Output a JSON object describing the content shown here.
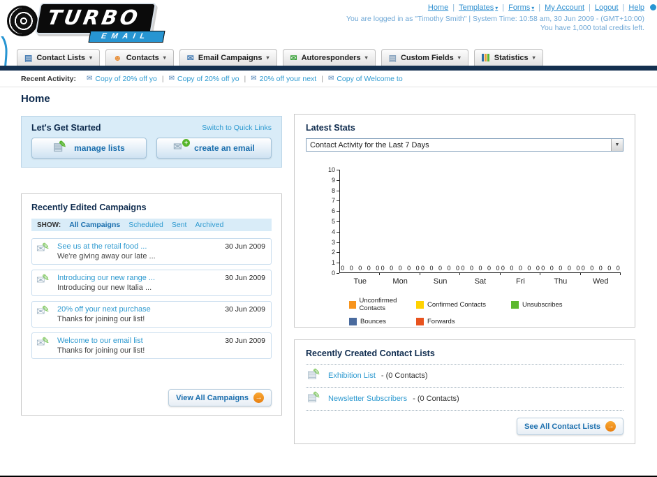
{
  "icons": {
    "chevron_down": "▾",
    "separator": "|",
    "arrow_right": "→",
    "envelope": "✉",
    "pencil": "✎",
    "card": "▤",
    "person": "☻",
    "select_arrow": "▼",
    "plus": "+"
  },
  "header": {
    "logo_primary": "TURBO",
    "logo_secondary": "EMAIL",
    "links": [
      {
        "label": "Home"
      },
      {
        "label": "Templates"
      },
      {
        "label": "Forms"
      },
      {
        "label": "My Account"
      },
      {
        "label": "Logout"
      },
      {
        "label": "Help"
      }
    ],
    "status_line1": "You are logged in as \"Timothy Smith\" | System Time: 10:58 am, 30 Jun 2009 - (GMT+10:00)",
    "status_line2": "You have 1,000 total credits left."
  },
  "nav_tabs": [
    {
      "label": "Contact Lists"
    },
    {
      "label": "Contacts"
    },
    {
      "label": "Email Campaigns"
    },
    {
      "label": "Autoresponders"
    },
    {
      "label": "Custom Fields"
    },
    {
      "label": "Statistics"
    }
  ],
  "recent_activity": {
    "label": "Recent Activity:",
    "items": [
      "Copy of 20% off yo",
      "Copy of 20% off yo",
      "20% off your next",
      "Copy of Welcome to"
    ]
  },
  "page": {
    "title": "Home"
  },
  "get_started": {
    "title": "Let's Get Started",
    "switch_link": "Switch to Quick Links",
    "manage_lists": "manage lists",
    "create_email": "create an email"
  },
  "campaigns": {
    "title": "Recently Edited Campaigns",
    "show_label": "SHOW:",
    "tabs": [
      "All Campaigns",
      "Scheduled",
      "Sent",
      "Archived"
    ],
    "items": [
      {
        "title": "See us at the retail food ...",
        "subtitle": "We're giving away our late ...",
        "date": "30 Jun 2009"
      },
      {
        "title": "Introducing our new range ...",
        "subtitle": "Introducing our new Italia ...",
        "date": "30 Jun 2009"
      },
      {
        "title": "20% off your next purchase",
        "subtitle": "Thanks for joining our list!",
        "date": "30 Jun 2009"
      },
      {
        "title": "Welcome to our email list",
        "subtitle": "Thanks for joining our list!",
        "date": "30 Jun 2009"
      }
    ],
    "view_all": "View All Campaigns"
  },
  "stats": {
    "title": "Latest Stats",
    "dropdown_value": "Contact Activity for the Last 7 Days",
    "chart_data": {
      "type": "bar",
      "title": "Contact Activity for the Last 7 Days",
      "categories": [
        "Tue",
        "Mon",
        "Sun",
        "Sat",
        "Fri",
        "Thu",
        "Wed"
      ],
      "series": [
        {
          "name": "Unconfirmed Contacts",
          "color": "#f7941d",
          "values": [
            0,
            0,
            0,
            0,
            0,
            0,
            0
          ]
        },
        {
          "name": "Confirmed Contacts",
          "color": "#ffd200",
          "values": [
            0,
            0,
            0,
            0,
            0,
            0,
            0
          ]
        },
        {
          "name": "Unsubscribes",
          "color": "#5cb82e",
          "values": [
            0,
            0,
            0,
            0,
            0,
            0,
            0
          ]
        },
        {
          "name": "Bounces",
          "color": "#4a6b9e",
          "values": [
            0,
            0,
            0,
            0,
            0,
            0,
            0
          ]
        },
        {
          "name": "Forwards",
          "color": "#e8531e",
          "values": [
            0,
            0,
            0,
            0,
            0,
            0,
            0
          ]
        }
      ],
      "ylim": [
        0,
        10
      ],
      "ytick_step": 1,
      "grid": false,
      "legend_position": "bottom"
    }
  },
  "contact_lists": {
    "title": "Recently Created Contact Lists",
    "items": [
      {
        "name": "Exhibition List",
        "detail": "- (0 Contacts)"
      },
      {
        "name": "Newsletter Subscribers",
        "detail": "- (0 Contacts)"
      }
    ],
    "see_all": "See All Contact Lists"
  }
}
